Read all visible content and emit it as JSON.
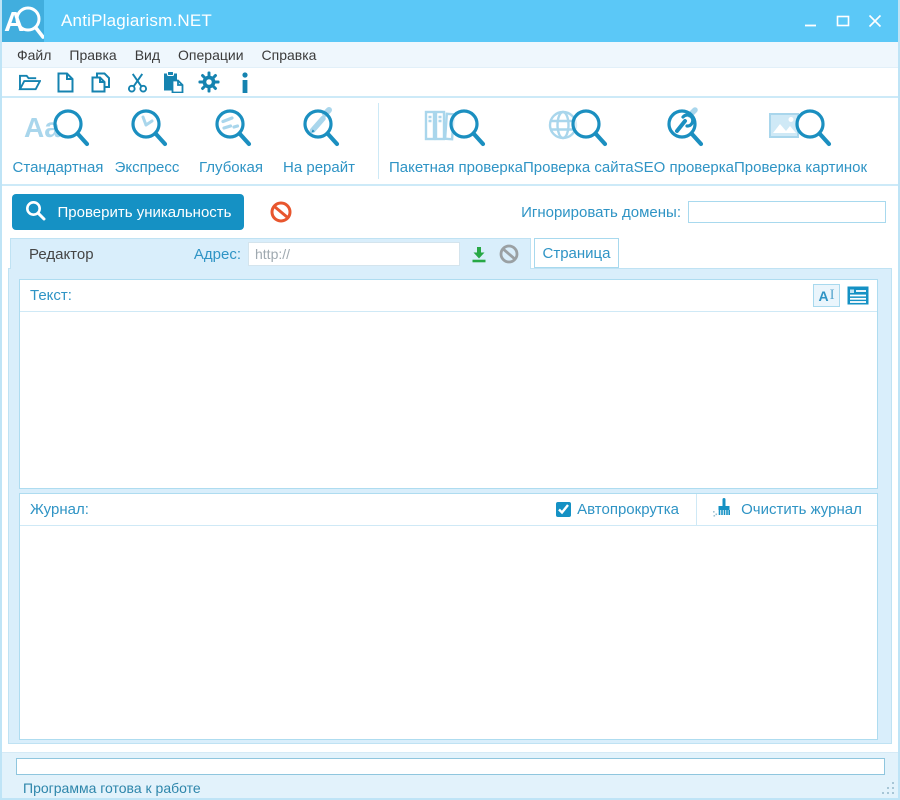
{
  "window": {
    "title": "AntiPlagiarism.NET",
    "controls": [
      "minimize",
      "maximize",
      "close"
    ]
  },
  "menu": {
    "items": [
      "Файл",
      "Правка",
      "Вид",
      "Операции",
      "Справка"
    ]
  },
  "toolbar": {
    "buttons": [
      "open-file",
      "new-file",
      "copy",
      "cut",
      "paste",
      "settings",
      "about"
    ]
  },
  "modes": {
    "items": [
      {
        "label": "Стандартная",
        "icon": "standard-check-icon"
      },
      {
        "label": "Экспресс",
        "icon": "express-check-icon"
      },
      {
        "label": "Глубокая",
        "icon": "deep-check-icon"
      },
      {
        "label": "На рерайт",
        "icon": "rewrite-check-icon"
      }
    ]
  },
  "tools": {
    "items": [
      {
        "label": "Пакетная проверка",
        "icon": "batch-check-icon"
      },
      {
        "label": "Проверка сайта",
        "icon": "site-check-icon"
      },
      {
        "label": "SEO проверка",
        "icon": "seo-check-icon"
      },
      {
        "label": "Проверка картинок",
        "icon": "image-check-icon"
      }
    ]
  },
  "actions": {
    "check_button_label": "Проверить уникальность",
    "ignore_domains_label": "Игнорировать домены:",
    "ignore_domains_value": ""
  },
  "tabs": {
    "editor_label": "Редактор",
    "page_label": "Страница",
    "address_label": "Адрес:",
    "address_placeholder": "http://",
    "address_value": ""
  },
  "editor": {
    "text_label": "Текст:",
    "content": ""
  },
  "journal": {
    "label": "Журнал:",
    "autoscroll_label": "Автопрокрутка",
    "autoscroll_checked": true,
    "clear_label": "Очистить журнал",
    "content": ""
  },
  "status": {
    "message": "Программа готова к работе",
    "progress_percent": 0
  },
  "icons": {
    "app-logo-icon": "letter A with magnifier",
    "search-icon": "magnifier",
    "stop-icon": "crossed circle",
    "download-icon": "green down arrow",
    "cancel-icon": "gray crossed circle",
    "font-cursor-icon": "A with text caret",
    "log-view-icon": "list lines",
    "broom-icon": "cleaning brush",
    "gear-icon": "settings gear",
    "info-icon": "letter i"
  },
  "colors": {
    "titlebar": "#5bc8f7",
    "accent_button": "#1591c4",
    "accent_text": "#2f94c5",
    "content_bg": "#d9eefb",
    "stop_red": "#e8562e",
    "download_green": "#27a845",
    "panel_border": "#aedcf0"
  }
}
